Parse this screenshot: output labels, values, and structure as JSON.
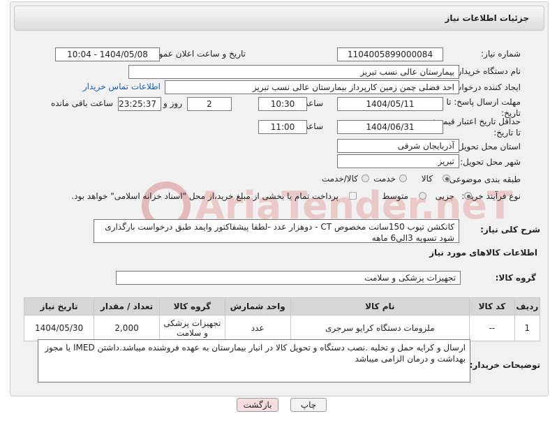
{
  "header": {
    "title": "جزئیات اطلاعات نیاز"
  },
  "fields": {
    "need_number_label": "شماره نیاز:",
    "need_number": "1104005899000084",
    "announce_label": "تاریخ و ساعت اعلان عمومی:",
    "announce_value": "1404/05/08 - 10:04",
    "buyer_org_label": "نام دستگاه خریدار:",
    "buyer_org": "بیمارستان عالی نسب تبریز",
    "creator_label": "ایجاد کننده درخواست:",
    "creator": "احد فضلی چمن زمین کارپرداز  بیمارستان عالی نسب تبریز",
    "contact_link": "اطلاعات تماس خریدار",
    "reply_deadline_label": "مهلت ارسال پاسخ: تا تاریخ:",
    "reply_date": "1404/05/11",
    "time_label": "ساعت",
    "reply_time": "10:30",
    "days_value": "2",
    "days_label": "روز و",
    "remaining_time": "23:25:37",
    "remaining_label": "ساعت باقی مانده",
    "price_validity_label": "حداقل تاریخ اعتبار قیمت: تا تاریخ:",
    "validity_date": "1404/06/31",
    "validity_time": "11:00",
    "province_label": "استان محل تحویل:",
    "province": "آذربایجان شرقی",
    "city_label": "شهر محل تحویل:",
    "city": "تبریز",
    "category_label": "طبقه بندی موضوعی:",
    "category_options": [
      "کالا",
      "خدمت",
      "کالا/خدمت"
    ],
    "process_label": "نوع فرآیند خرید :",
    "process_options": [
      "جزیی",
      "متوسط"
    ],
    "payment_note": "پرداخت تمام یا بخشی از مبلغ خرید،از محل \"اسناد خزانه اسلامی\" خواهد بود."
  },
  "need_summary": {
    "label": "شرح کلی نیاز:",
    "text": "کانکشن تیوب 150سانت مخصوص CT   - دوهزار عدد -لطفا پیشفاکتور وایمد طبق درخواست بارگذاری شود تسویه 3الی6 ماهه"
  },
  "goods_section": {
    "title": "اطلاعات کالاهای مورد نیاز",
    "group_label": "گروه کالا:",
    "group_value": "تجهیزات پزشکی و سلامت"
  },
  "table": {
    "headers": [
      "ردیف",
      "کد کالا",
      "نام کالا",
      "واحد شمارش",
      "گروه کالا",
      "تعداد / مقدار",
      "تاریخ نیاز"
    ],
    "rows": [
      {
        "row": "1",
        "code": "--",
        "name": "ملزومات دستگاه کرایو سرجری",
        "unit": "عدد",
        "group": "تجهیزات پزشکی و سلامت",
        "qty": "2,000",
        "date": "1404/05/30"
      }
    ]
  },
  "buyer_notes": {
    "label": "توضیحات خریدار:",
    "text": "ارسال و کرایه حمل و تخلیه .نصب دستگاه و تحویل کالا در انبار بیمارستان به عهده فروشنده میباشد.داشتن IMED یا مجوز بهداشت و درمان الزامی میباشد"
  },
  "buttons": {
    "print": "چاپ",
    "back": "بازگشت"
  },
  "watermark": {
    "text": "AriaTender.neT"
  },
  "colors": {
    "link": "#1a5fb4",
    "back_button_bg": "#f7dede",
    "watermark": "#e3b9b9"
  }
}
